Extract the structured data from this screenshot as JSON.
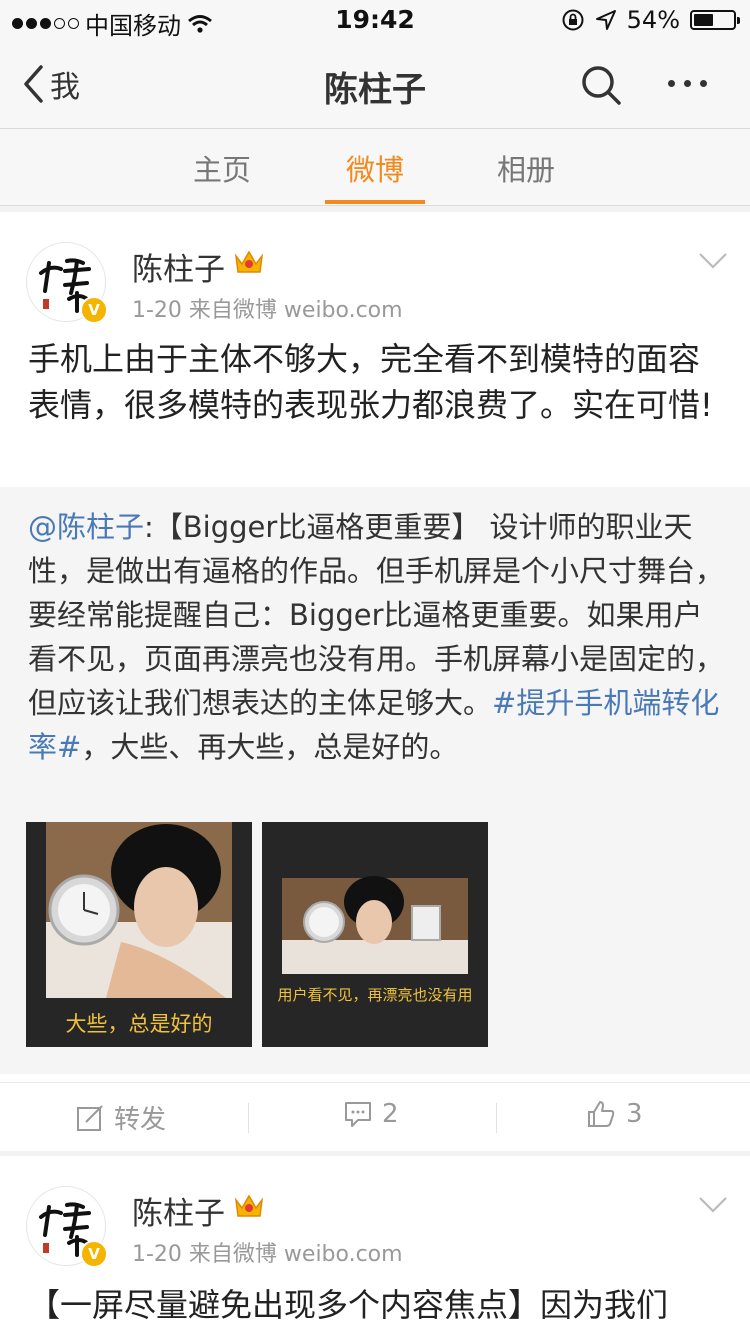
{
  "status_bar": {
    "carrier": "中国移动",
    "time": "19:42",
    "battery": "54%",
    "battery_level": 0.54
  },
  "nav": {
    "back_label": "我",
    "title": "陈柱子"
  },
  "tabs": [
    {
      "label": "主页",
      "active": false
    },
    {
      "label": "微博",
      "active": true
    },
    {
      "label": "相册",
      "active": false
    }
  ],
  "posts": [
    {
      "username": "陈柱子",
      "meta": "1-20  来自微博 weibo.com",
      "text": "手机上由于主体不够大，完全看不到模特的面容表情，很多模特的表现张力都浪费了。实在可惜!",
      "retweet": {
        "mention": "@陈柱子",
        "text_a": ":【Bigger比逼格更重要】 设计师的职业天性，是做出有逼格的作品。但手机屏是个小尺寸舞台，要经常能提醒自己：Bigger比逼格更重要。如果用户看不见，页面再漂亮也没有用。手机屏幕小是固定的，但应该让我们想表达的主体足够大。",
        "hashtag": "#提升手机端转化率#",
        "text_b": "，大些、再大些，总是好的。",
        "images": [
          {
            "caption": "大些，总是好的"
          },
          {
            "caption": "用户看不见，再漂亮也没有用"
          }
        ]
      },
      "actions": {
        "repost_label": "转发",
        "comment_count": "2",
        "like_count": "3"
      }
    },
    {
      "username": "陈柱子",
      "meta": "1-20  来自微博 weibo.com",
      "text": "【一屏尽量避免出现多个内容焦点】因为我们"
    }
  ],
  "colors": {
    "accent": "#f28a1f",
    "link": "#4a7ab6",
    "caption": "#f0c23a"
  }
}
